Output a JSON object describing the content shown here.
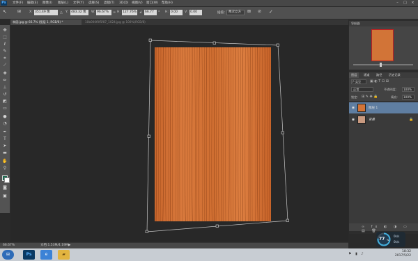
{
  "app": {
    "logo": "Ps"
  },
  "menubar": {
    "items": [
      "文件(F)",
      "编辑(E)",
      "图像(I)",
      "图层(L)",
      "文字(Y)",
      "选择(S)",
      "滤镜(T)",
      "3D(D)",
      "视图(V)",
      "窗口(W)",
      "帮助(H)"
    ],
    "window_controls": [
      "–",
      "□",
      "×"
    ]
  },
  "options_bar": {
    "x_label": "X:",
    "x_value": "351.49 像",
    "y_label": "Y:",
    "y_value": "483.32 像",
    "w_label": "W:",
    "w_value": "96.67%",
    "h_label": "H:",
    "h_value": "127.76%",
    "angle_value": "66.77",
    "hskew_label": "H:",
    "hskew_value": "0.00",
    "vskew_label": "V:",
    "vskew_value": "0.00",
    "interp_label": "插值：",
    "interp_value": "两次立方"
  },
  "tabs": [
    {
      "label": "林园.jpg @ 66.7% (图层 1, RGB/8) *",
      "active": true
    },
    {
      "label": "10b000f0f5f87_1024.jpg @ 100%(RGB/8)",
      "active": false
    }
  ],
  "status": {
    "zoom": "66.67%",
    "doc": "文档:1.53M/4.19M"
  },
  "navigator": {
    "title": "导航器"
  },
  "layers_panel": {
    "tabs": [
      "图层",
      "通道",
      "路径",
      "历史记录"
    ],
    "kind_filter": "P 类型",
    "blend_mode": "正常",
    "opacity_label": "不透明度:",
    "opacity_value": "100%",
    "lock_label": "锁定:",
    "fill_label": "填充:",
    "fill_value": "100%",
    "layers": [
      {
        "name": "图层 1",
        "selected": true
      },
      {
        "name": "背景",
        "selected": false
      }
    ]
  },
  "gauge": {
    "value": "77",
    "unit": "%",
    "line1": "0k/s",
    "line2": "0k/s"
  },
  "taskbar": {
    "time": "18:32",
    "date": "2017/5/22",
    "items": [
      "windows-start",
      "photoshop",
      "browser",
      "folder"
    ]
  },
  "colors": {
    "wood_base": "#d27437",
    "wood_dark": "#7a3510",
    "selected_layer": "#5f7ea1",
    "canvas_bg": "#282828"
  }
}
